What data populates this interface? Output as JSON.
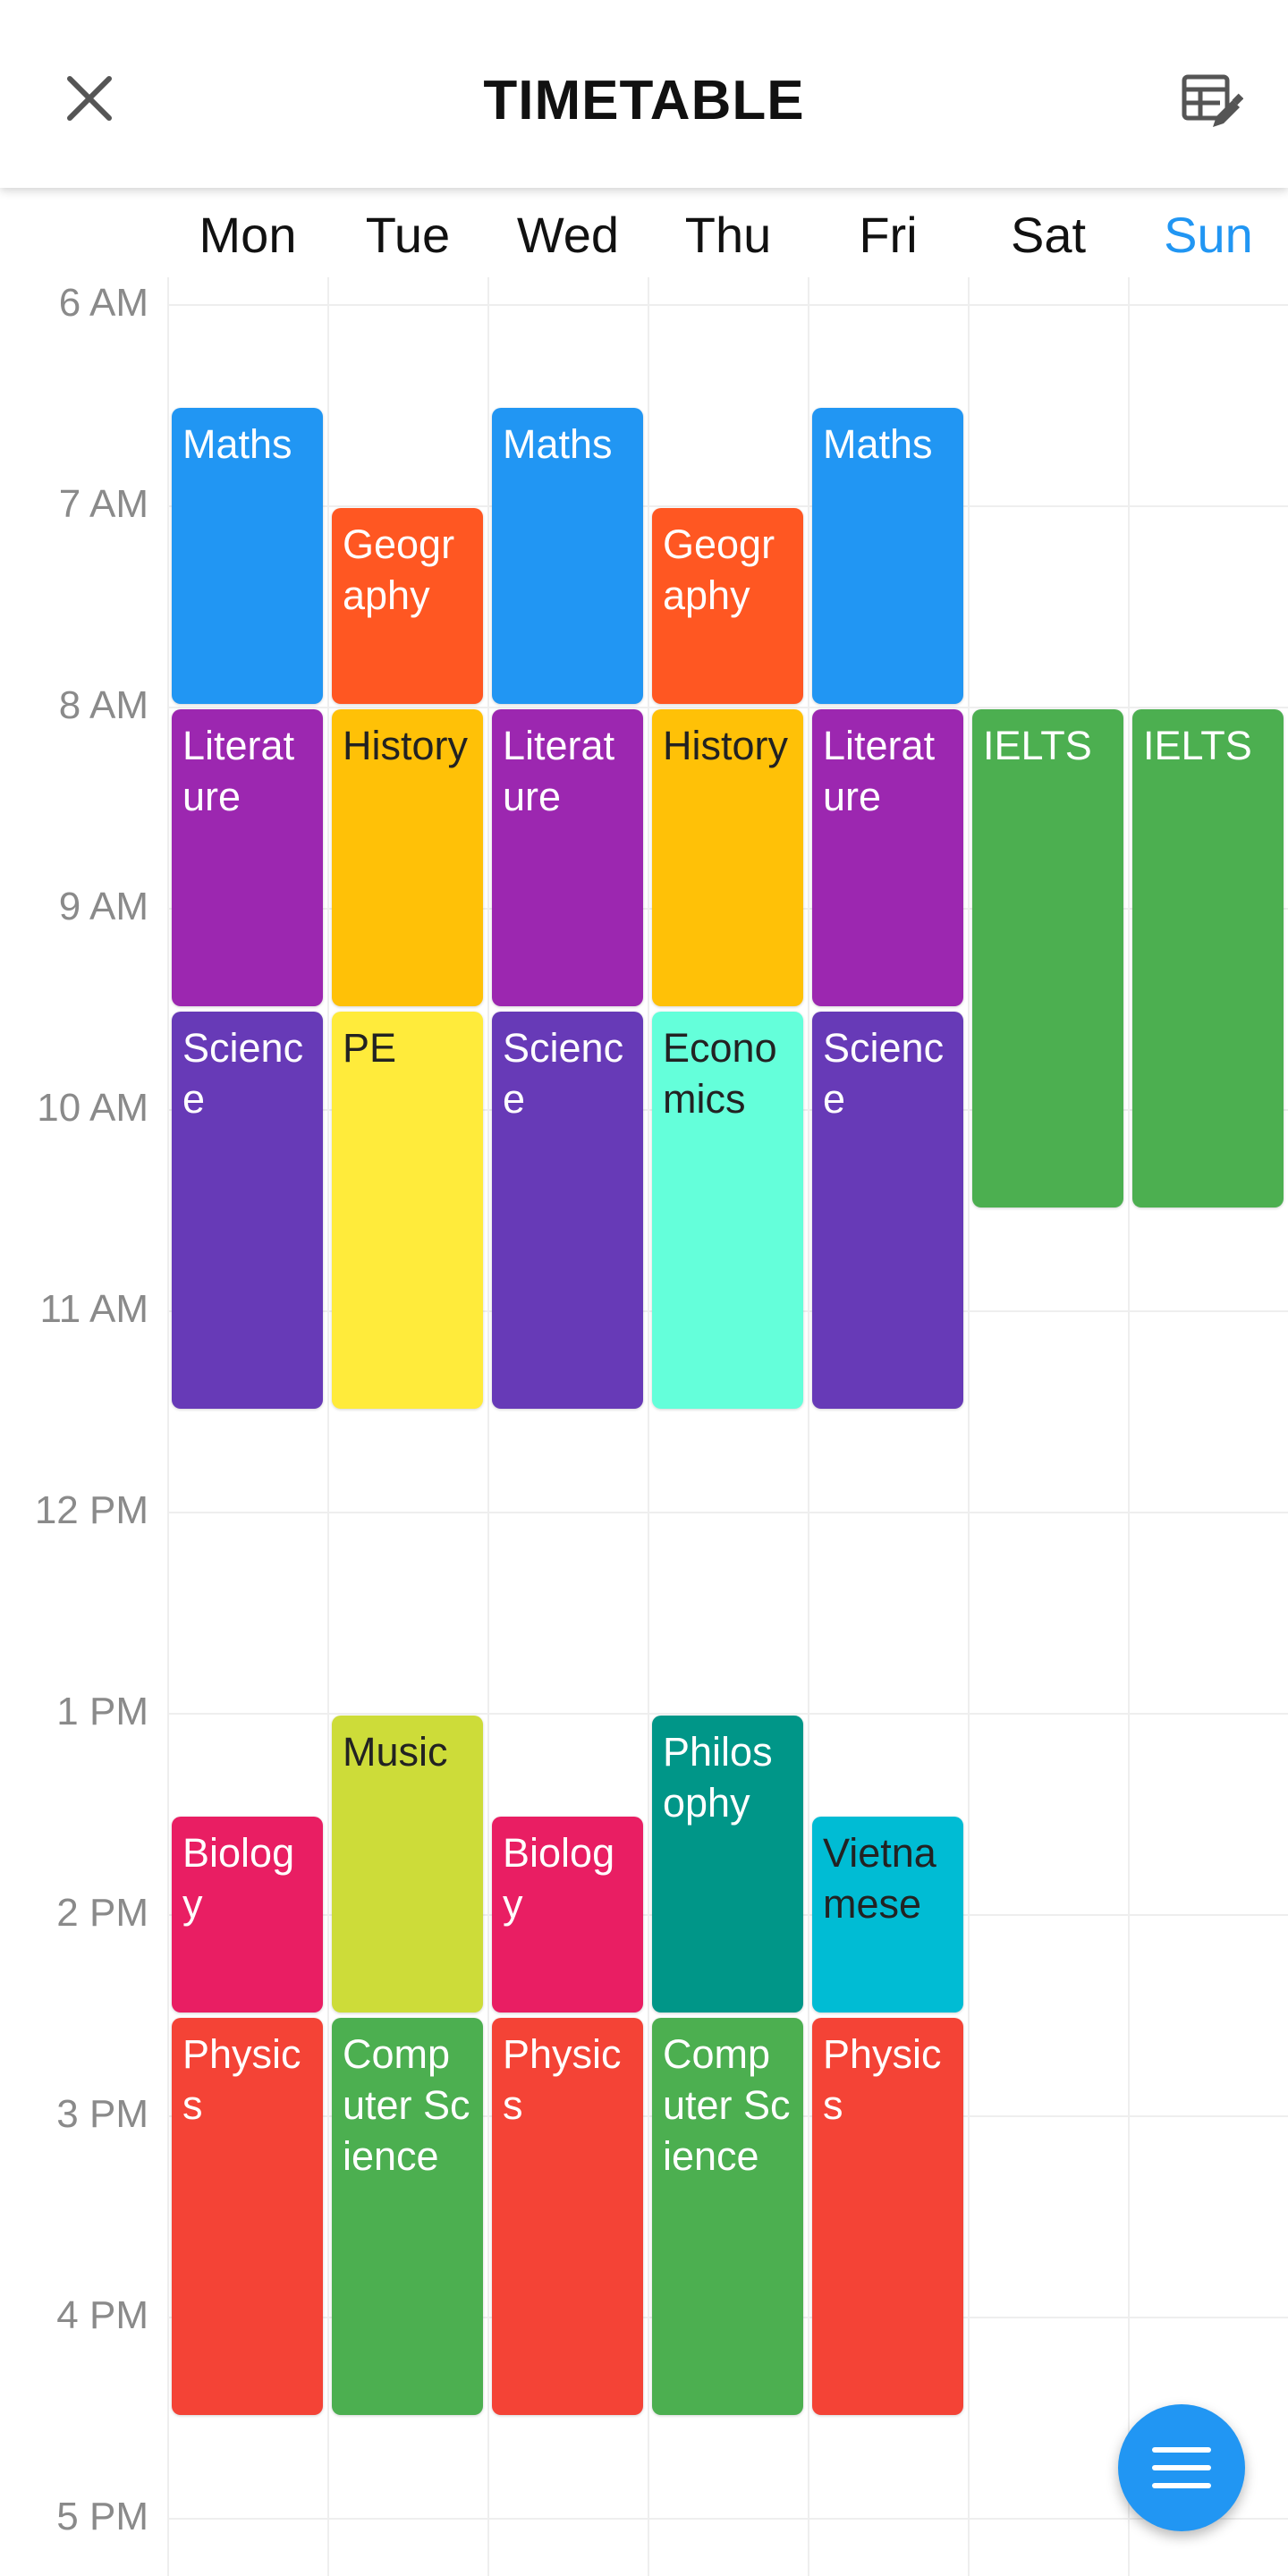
{
  "header": {
    "title": "TIMETABLE"
  },
  "days": [
    {
      "label": "Mon",
      "highlight": false
    },
    {
      "label": "Tue",
      "highlight": false
    },
    {
      "label": "Wed",
      "highlight": false
    },
    {
      "label": "Thu",
      "highlight": false
    },
    {
      "label": "Fri",
      "highlight": false
    },
    {
      "label": "Sat",
      "highlight": false
    },
    {
      "label": "Sun",
      "highlight": true
    }
  ],
  "hours": [
    "6 AM",
    "7 AM",
    "8 AM",
    "9 AM",
    "10 AM",
    "11 AM",
    "12 PM",
    "1 PM",
    "2 PM",
    "3 PM",
    "4 PM",
    "5 PM"
  ],
  "colors": {
    "today": "#2196f3",
    "maths": "#2196f3",
    "geography": "#ff5722",
    "literature": "#9c27b0",
    "history": "#ffc107",
    "science": "#673ab7",
    "pe": "#ffeb3b",
    "economics": "#64ffda",
    "ielts": "#4caf50",
    "music": "#cddc39",
    "philosophy": "#009688",
    "biology": "#e91e63",
    "vietnamese": "#00bcd4",
    "physics": "#f44336",
    "computer_science": "#4caf50"
  },
  "events": [
    {
      "name": "Maths",
      "day": 0,
      "start": "06:30",
      "end": "08:00",
      "color": "#2196f3",
      "text_color": "#ffffff"
    },
    {
      "name": "Literature",
      "day": 0,
      "start": "08:00",
      "end": "09:30",
      "color": "#9c27b0",
      "text_color": "#ffffff"
    },
    {
      "name": "Science",
      "day": 0,
      "start": "09:30",
      "end": "11:30",
      "color": "#673ab7",
      "text_color": "#ffffff"
    },
    {
      "name": "Biology",
      "day": 0,
      "start": "13:30",
      "end": "14:30",
      "color": "#e91e63",
      "text_color": "#ffffff"
    },
    {
      "name": "Physics",
      "day": 0,
      "start": "14:30",
      "end": "16:30",
      "color": "#f44336",
      "text_color": "#ffffff"
    },
    {
      "name": "Geography",
      "day": 1,
      "start": "07:00",
      "end": "08:00",
      "color": "#ff5722",
      "text_color": "#ffffff"
    },
    {
      "name": "History",
      "day": 1,
      "start": "08:00",
      "end": "09:30",
      "color": "#ffc107",
      "text_color": "#222222"
    },
    {
      "name": "PE",
      "day": 1,
      "start": "09:30",
      "end": "11:30",
      "color": "#ffeb3b",
      "text_color": "#222222"
    },
    {
      "name": "Music",
      "day": 1,
      "start": "13:00",
      "end": "14:30",
      "color": "#cddc39",
      "text_color": "#222222"
    },
    {
      "name": "Computer Science",
      "day": 1,
      "start": "14:30",
      "end": "16:30",
      "color": "#4caf50",
      "text_color": "#ffffff"
    },
    {
      "name": "Maths",
      "day": 2,
      "start": "06:30",
      "end": "08:00",
      "color": "#2196f3",
      "text_color": "#ffffff"
    },
    {
      "name": "Literature",
      "day": 2,
      "start": "08:00",
      "end": "09:30",
      "color": "#9c27b0",
      "text_color": "#ffffff"
    },
    {
      "name": "Science",
      "day": 2,
      "start": "09:30",
      "end": "11:30",
      "color": "#673ab7",
      "text_color": "#ffffff"
    },
    {
      "name": "Biology",
      "day": 2,
      "start": "13:30",
      "end": "14:30",
      "color": "#e91e63",
      "text_color": "#ffffff"
    },
    {
      "name": "Physics",
      "day": 2,
      "start": "14:30",
      "end": "16:30",
      "color": "#f44336",
      "text_color": "#ffffff"
    },
    {
      "name": "Geography",
      "day": 3,
      "start": "07:00",
      "end": "08:00",
      "color": "#ff5722",
      "text_color": "#ffffff"
    },
    {
      "name": "History",
      "day": 3,
      "start": "08:00",
      "end": "09:30",
      "color": "#ffc107",
      "text_color": "#222222"
    },
    {
      "name": "Economics",
      "day": 3,
      "start": "09:30",
      "end": "11:30",
      "color": "#64ffda",
      "text_color": "#222222"
    },
    {
      "name": "Philosophy",
      "day": 3,
      "start": "13:00",
      "end": "14:30",
      "color": "#009688",
      "text_color": "#ffffff"
    },
    {
      "name": "Computer Science",
      "day": 3,
      "start": "14:30",
      "end": "16:30",
      "color": "#4caf50",
      "text_color": "#ffffff"
    },
    {
      "name": "Maths",
      "day": 4,
      "start": "06:30",
      "end": "08:00",
      "color": "#2196f3",
      "text_color": "#ffffff"
    },
    {
      "name": "Literature",
      "day": 4,
      "start": "08:00",
      "end": "09:30",
      "color": "#9c27b0",
      "text_color": "#ffffff"
    },
    {
      "name": "Science",
      "day": 4,
      "start": "09:30",
      "end": "11:30",
      "color": "#673ab7",
      "text_color": "#ffffff"
    },
    {
      "name": "Vietnamese",
      "day": 4,
      "start": "13:30",
      "end": "14:30",
      "color": "#00bcd4",
      "text_color": "#222222"
    },
    {
      "name": "Physics",
      "day": 4,
      "start": "14:30",
      "end": "16:30",
      "color": "#f44336",
      "text_color": "#ffffff"
    },
    {
      "name": "IELTS",
      "day": 5,
      "start": "08:00",
      "end": "10:30",
      "color": "#4caf50",
      "text_color": "#ffffff"
    },
    {
      "name": "IELTS",
      "day": 6,
      "start": "08:00",
      "end": "10:30",
      "color": "#4caf50",
      "text_color": "#ffffff"
    }
  ],
  "icons": {
    "close": "close-icon",
    "edit": "table-edit-icon",
    "menu": "menu-icon"
  }
}
